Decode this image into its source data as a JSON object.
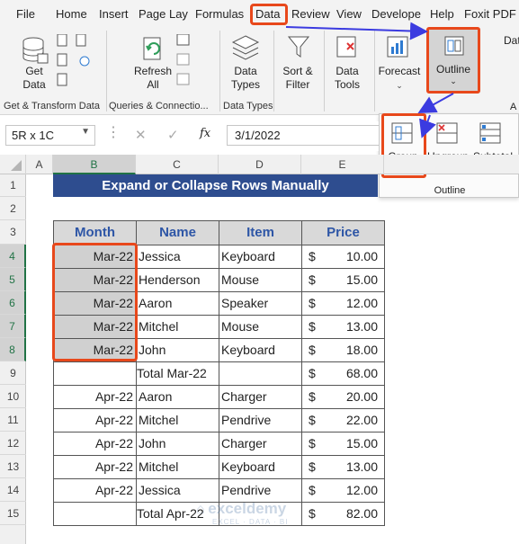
{
  "tabs": [
    "File",
    "Home",
    "Insert",
    "Page Layo",
    "Formulas",
    "Data",
    "Review",
    "View",
    "Develope",
    "Help",
    "Foxit PDF"
  ],
  "ribbon": {
    "get_data": "Get\nData",
    "get_data_chev": "⌄",
    "refresh": "Refresh",
    "refresh_all": "All",
    "data_types": "Data\nTypes",
    "sort_filter": "Sort &\nFilter",
    "data_tools": "Data\nTools",
    "forecast": "Forecast",
    "outline": "Outline",
    "dat_partial": "Dat",
    "a_partial": "A",
    "groups": {
      "get_transform": "Get & Transform Data",
      "queries": "Queries & Connectio...",
      "data_types": "Data Types"
    }
  },
  "outline_popup": {
    "group": "Group",
    "ungroup": "Ungroup",
    "subtotal": "Subtotal",
    "label": "Outline"
  },
  "formula_bar": {
    "name_box": "5R x 1C",
    "fx": "fx",
    "value": "3/1/2022"
  },
  "columns": [
    "A",
    "B",
    "C",
    "D",
    "E"
  ],
  "rows": [
    "1",
    "2",
    "3",
    "4",
    "5",
    "6",
    "7",
    "8",
    "9",
    "10",
    "11",
    "12",
    "13",
    "14",
    "15"
  ],
  "sheet": {
    "title": "Expand or Collapse Rows Manually",
    "headers": [
      "Month",
      "Name",
      "Item",
      "Price"
    ],
    "data": [
      {
        "month": "Mar-22",
        "name": "Jessica",
        "item": "Keyboard",
        "cur": "$",
        "price": "10.00"
      },
      {
        "month": "Mar-22",
        "name": "Henderson",
        "item": "Mouse",
        "cur": "$",
        "price": "15.00"
      },
      {
        "month": "Mar-22",
        "name": "Aaron",
        "item": "Speaker",
        "cur": "$",
        "price": "12.00"
      },
      {
        "month": "Mar-22",
        "name": "Mitchel",
        "item": "Mouse",
        "cur": "$",
        "price": "13.00"
      },
      {
        "month": "Mar-22",
        "name": "John",
        "item": "Keyboard",
        "cur": "$",
        "price": "18.00"
      },
      {
        "total": "Total Mar-22",
        "cur": "$",
        "price": "68.00"
      },
      {
        "month": "Apr-22",
        "name": "Aaron",
        "item": "Charger",
        "cur": "$",
        "price": "20.00"
      },
      {
        "month": "Apr-22",
        "name": "Mitchel",
        "item": "Pendrive",
        "cur": "$",
        "price": "22.00"
      },
      {
        "month": "Apr-22",
        "name": "John",
        "item": "Charger",
        "cur": "$",
        "price": "15.00"
      },
      {
        "month": "Apr-22",
        "name": "Mitchel",
        "item": "Keyboard",
        "cur": "$",
        "price": "13.00"
      },
      {
        "month": "Apr-22",
        "name": "Jessica",
        "item": "Pendrive",
        "cur": "$",
        "price": "12.00"
      },
      {
        "total": "Total Apr-22",
        "cur": "$",
        "price": "82.00"
      }
    ]
  },
  "watermark": {
    "name": "exceldemy",
    "tagline": "EXCEL · DATA · BI"
  },
  "colors": {
    "accent": "#e8481b",
    "arrow": "#3b3be0",
    "title_bg": "#2e4d8f",
    "header_text": "#2e56a6"
  }
}
